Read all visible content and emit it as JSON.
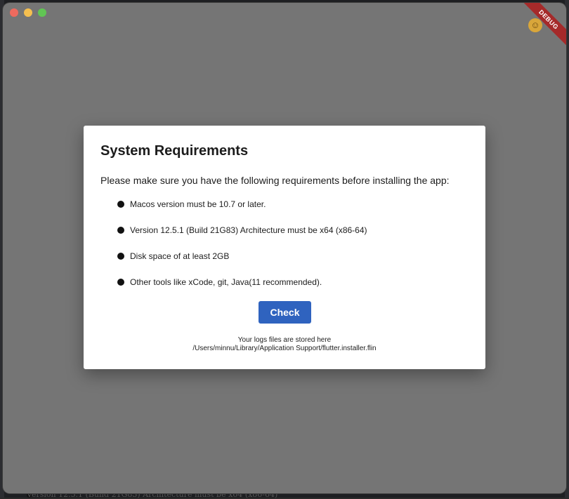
{
  "window": {
    "debug_banner": "DEBUG"
  },
  "dialog": {
    "title": "System Requirements",
    "intro": "Please make sure you have the following requirements before installing the app:",
    "requirements": [
      "Macos version must be 10.7 or later.",
      "Version 12.5.1 (Build 21G83) Architecture must be x64 (x86-64)",
      "Disk space of at least 2GB",
      "Other tools like xCode, git, Java(11 recommended)."
    ],
    "check_label": "Check",
    "logs_label": "Your logs files are stored here",
    "logs_path": "/Users/minnu/Library/Application Support/flutter.installer.flin"
  },
  "background": {
    "partial_text": "Version 12.5.1 (Build 21G83) Architecture must be x64 (x86-64)"
  },
  "colors": {
    "overlay": "#757575",
    "dialog_bg": "#ffffff",
    "button_bg": "#2f63bf",
    "debug_ribbon": "#a52a2a",
    "traffic_close": "#ed6a5e",
    "traffic_minimize": "#f5bf4f",
    "traffic_zoom": "#61c554"
  },
  "icons": {
    "app_icon": "emoji-face-icon"
  }
}
